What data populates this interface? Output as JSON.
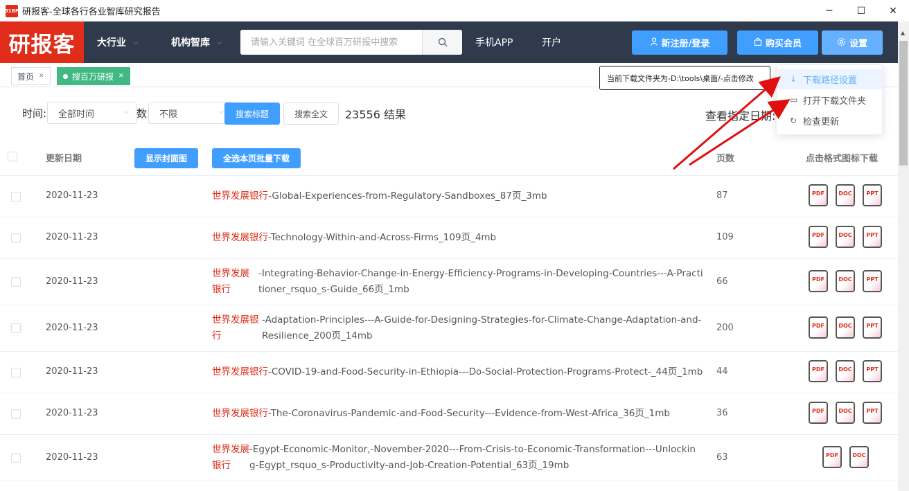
{
  "window": {
    "icon_text": "51BP",
    "title": "研报客-全球各行各业智库研究报告",
    "controls": [
      "─",
      "☐",
      "✕"
    ]
  },
  "header": {
    "logo": "研报客",
    "nav": [
      {
        "label": "大行业",
        "chevron": "⌵"
      },
      {
        "label": "机构智库",
        "chevron": "⌵"
      }
    ],
    "search_placeholder": "请输入关键词 在全球百万研报中搜索",
    "links": [
      "手机APP",
      "开户"
    ],
    "register_label": "新注册/登录",
    "buy_label": "购买会员",
    "settings_label": "设置"
  },
  "tabs": [
    {
      "label": "首页",
      "active": false
    },
    {
      "label": "搜百万研报",
      "active": true
    }
  ],
  "filter": {
    "time_label": "时间:",
    "time_value": "全部时间",
    "pages_label": "数:",
    "pages_value": "不限",
    "search_title_btn": "搜索标题",
    "search_full_btn": "搜索全文",
    "result_count": "23556 结果",
    "date_label": "查看指定日期:"
  },
  "table": {
    "col_date": "更新日期",
    "show_cover_btn": "显示封面图",
    "select_all_btn": "全选本页批量下载",
    "col_pages": "页数",
    "col_download": "点击格式图标下载",
    "rows": [
      {
        "date": "2020-11-23",
        "inst": "世界发展银行",
        "title": "-Global-Experiences-from-Regulatory-Sandboxes_87页_3mb",
        "pages": "87",
        "formats": [
          "PDF",
          "DOC",
          "PPT"
        ]
      },
      {
        "date": "2020-11-23",
        "inst": "世界发展银行",
        "title": "-Technology-Within-and-Across-Firms_109页_4mb",
        "pages": "109",
        "formats": [
          "PDF",
          "DOC",
          "PPT"
        ]
      },
      {
        "date": "2020-11-23",
        "inst": "世界发展银行",
        "title": "-Integrating-Behavior-Change-in-Energy-Efficiency-Programs-in-Developing-Countries---A-Practitioner_rsquo_s-Guide_66页_1mb",
        "pages": "66",
        "formats": [
          "PDF",
          "DOC",
          "PPT"
        ]
      },
      {
        "date": "2020-11-23",
        "inst": "世界发展银行",
        "title": "-Adaptation-Principles---A-Guide-for-Designing-Strategies-for-Climate-Change-Adaptation-and-Resilience_200页_14mb",
        "pages": "200",
        "formats": [
          "PDF",
          "DOC",
          "PPT"
        ]
      },
      {
        "date": "2020-11-23",
        "inst": "世界发展银行",
        "title": "-COVID-19-and-Food-Security-in-Ethiopia---Do-Social-Protection-Programs-Protect-_44页_1mb",
        "pages": "44",
        "formats": [
          "PDF",
          "DOC",
          "PPT"
        ]
      },
      {
        "date": "2020-11-23",
        "inst": "世界发展银行",
        "title": "-The-Coronavirus-Pandemic-and-Food-Security---Evidence-from-West-Africa_36页_1mb",
        "pages": "36",
        "formats": [
          "PDF",
          "DOC",
          "PPT"
        ]
      },
      {
        "date": "2020-11-23",
        "inst": "世界发展银行",
        "title": "-Egypt-Economic-Monitor,-November-2020---From-Crisis-to-Economic-Transformation---Unlocking-Egypt_rsquo_s-Productivity-and-Job-Creation-Potential_63页_19mb",
        "pages": "63",
        "formats": [
          "PDF",
          "DOC"
        ]
      }
    ]
  },
  "dropdown": {
    "items": [
      {
        "icon": "↓",
        "label": "下载路径设置"
      },
      {
        "icon": "▭",
        "label": "打开下载文件夹"
      },
      {
        "icon": "↻",
        "label": "检查更新"
      }
    ]
  },
  "tooltip": "当前下载文件夹为-D:\\tools\\桌面/-点击修改",
  "colors": {
    "accent": "#409eff",
    "brand": "#e02d1a",
    "header": "#2f3a4c",
    "tab_active": "#42b983"
  }
}
